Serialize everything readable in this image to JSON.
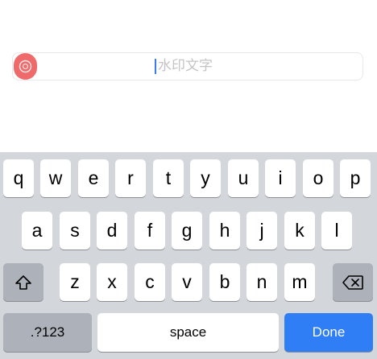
{
  "input": {
    "placeholder": "水印文字",
    "icon": "watermark-icon",
    "icon_color": "#ef6b6b",
    "caret_color": "#3c7cf0"
  },
  "keyboard": {
    "row1": [
      "q",
      "w",
      "e",
      "r",
      "t",
      "y",
      "u",
      "i",
      "o",
      "p"
    ],
    "row2": [
      "a",
      "s",
      "d",
      "f",
      "g",
      "h",
      "j",
      "k",
      "l"
    ],
    "row3": [
      "z",
      "x",
      "c",
      "v",
      "b",
      "n",
      "m"
    ],
    "shift_icon": "shift-icon",
    "delete_icon": "backspace-icon",
    "numbers_label": ".?123",
    "space_label": "space",
    "done_label": "Done",
    "done_color": "#2f7ef6"
  }
}
